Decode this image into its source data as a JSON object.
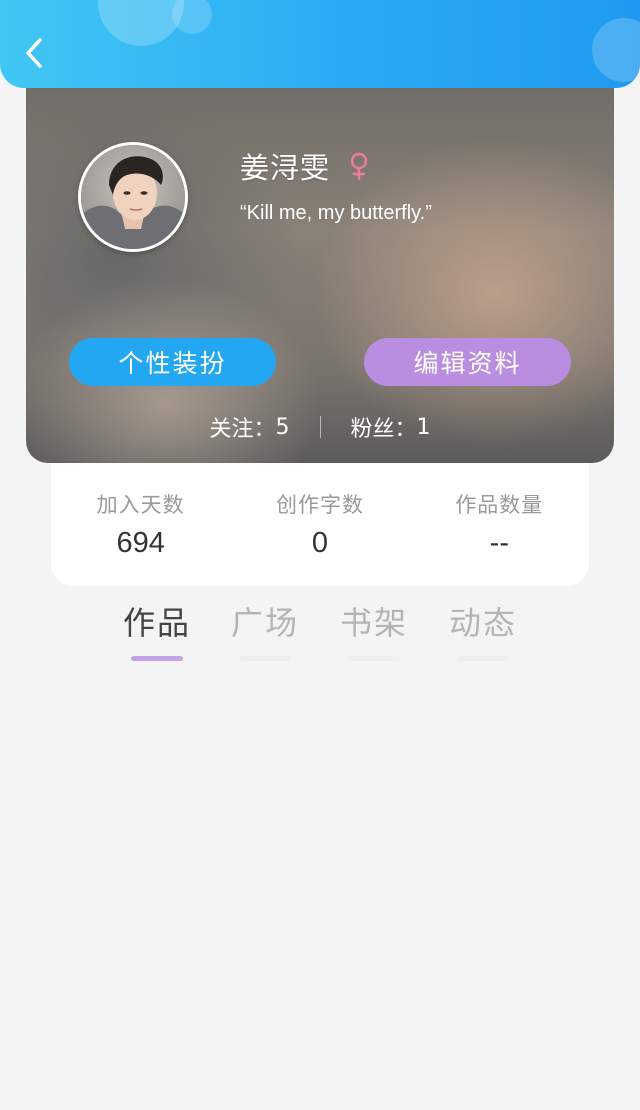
{
  "header": {
    "back_icon": "chevron-left-icon",
    "gradient_colors": [
      "#41c7f4",
      "#1e9af0"
    ]
  },
  "profile": {
    "name": "姜浔雯",
    "gender_icon": "female-icon",
    "gender_color": "#f27a9c",
    "signature": "“Kill me, my butterfly.”",
    "buttons": {
      "dress_up": {
        "label": "个性装扮",
        "color": "#23a7f2"
      },
      "edit_profile": {
        "label": "编辑资料",
        "color": "#b98ee0"
      }
    },
    "follow": {
      "following_label": "关注：",
      "following_count": "5",
      "fans_label": "粉丝：",
      "fans_count": "1"
    }
  },
  "stats": [
    {
      "label": "加入天数",
      "value": "694"
    },
    {
      "label": "创作字数",
      "value": "0"
    },
    {
      "label": "作品数量",
      "value": "--"
    }
  ],
  "tabs": [
    {
      "label": "作品",
      "active": true
    },
    {
      "label": "广场",
      "active": false
    },
    {
      "label": "书架",
      "active": false
    },
    {
      "label": "动态",
      "active": false
    }
  ],
  "tab_active_color": "#c3a3e6"
}
